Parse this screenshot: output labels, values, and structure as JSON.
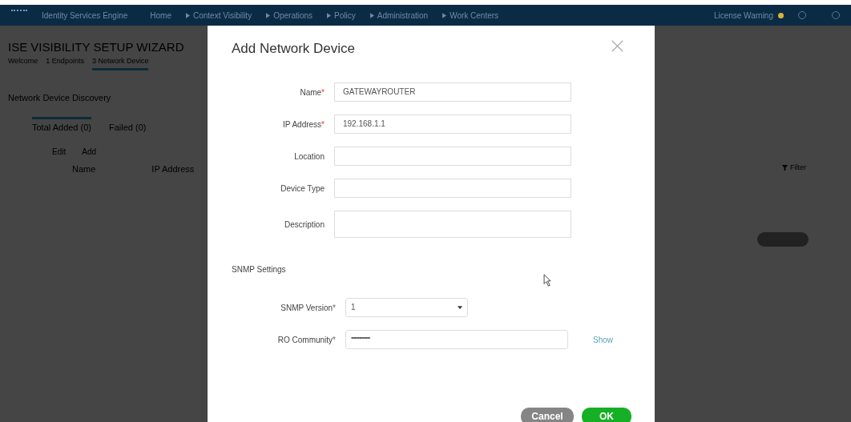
{
  "top_bar": {
    "product": "Identity Services Engine",
    "nav": [
      {
        "label": "Home",
        "has_arrow": false
      },
      {
        "label": "Context Visibility",
        "has_arrow": true
      },
      {
        "label": "Operations",
        "has_arrow": true
      },
      {
        "label": "Policy",
        "has_arrow": true
      },
      {
        "label": "Administration",
        "has_arrow": true
      },
      {
        "label": "Work Centers",
        "has_arrow": true
      }
    ],
    "license_warning": "License Warning"
  },
  "wizard": {
    "title": "ISE VISIBILITY SETUP WIZARD",
    "steps": [
      {
        "label": "Welcome",
        "selected": false
      },
      {
        "label": "1 Endpoints",
        "selected": false
      },
      {
        "label": "3 Network Device",
        "selected": true
      }
    ],
    "section": "Network Device Discovery",
    "tabs": [
      {
        "label": "Total Added (0)",
        "selected": true
      },
      {
        "label": "Failed (0)",
        "selected": false
      }
    ],
    "toolbar": [
      "Edit",
      "Add"
    ],
    "columns": [
      "Name",
      "IP Address"
    ],
    "filter": "Filter"
  },
  "dialog": {
    "title": "Add Network Device",
    "required_mark": "*",
    "fields": [
      {
        "kind": "text",
        "label": "Name",
        "required": true,
        "value": "GATEWAYROUTER"
      },
      {
        "kind": "text",
        "label": "IP Address",
        "required": true,
        "value": "192.168.1.1"
      },
      {
        "kind": "text",
        "label": "Location",
        "required": false
      },
      {
        "kind": "text",
        "label": "Device Type",
        "required": false
      },
      {
        "kind": "textarea",
        "label": "Description",
        "required": false
      }
    ],
    "snmp_title": "SNMP Settings",
    "snmp_fields": [
      {
        "kind": "select",
        "label": "SNMP Version",
        "required": true,
        "value": "1"
      },
      {
        "kind": "password",
        "label": "RO Community",
        "required": true,
        "value": "••••••••••••••••",
        "link": "Show"
      }
    ],
    "buttons": [
      {
        "label": "Cancel",
        "kind": "secondary"
      },
      {
        "label": "OK",
        "kind": "primary"
      }
    ]
  }
}
